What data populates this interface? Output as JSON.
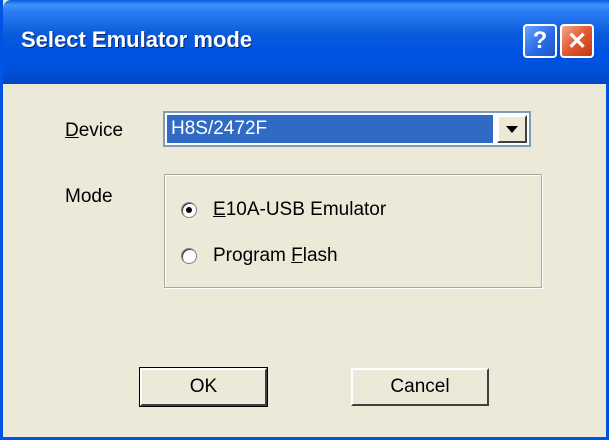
{
  "window": {
    "title": "Select Emulator mode",
    "help_label": "?",
    "close_label": "✕"
  },
  "device": {
    "label_first": "D",
    "label_rest": "evice",
    "selected": "H8S/2472F"
  },
  "mode": {
    "label": "Mode",
    "options": [
      {
        "underline": "E",
        "rest": "10A-USB Emulator",
        "checked": true
      },
      {
        "prefix": "Program ",
        "underline": "F",
        "rest": "lash",
        "checked": false
      }
    ]
  },
  "buttons": {
    "ok": "OK",
    "cancel": "Cancel"
  },
  "colors": {
    "titlebar": "#0054E3",
    "dialog_bg": "#ECE9D8",
    "selection": "#316AC5"
  }
}
